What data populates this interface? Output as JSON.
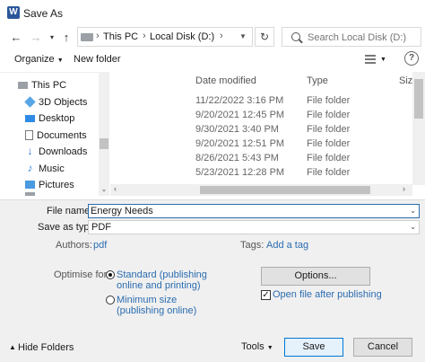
{
  "window": {
    "title": "Save As",
    "app_icon": "W"
  },
  "address": {
    "crumbs": [
      "This PC",
      "Local Disk (D:)"
    ],
    "search_placeholder": "Search Local Disk (D:)"
  },
  "toolbar": {
    "organize": "Organize",
    "new_folder": "New folder"
  },
  "nav": {
    "items": [
      {
        "label": "This PC",
        "icon": "pc-icon"
      },
      {
        "label": "3D Objects",
        "icon": "3d-objects-icon"
      },
      {
        "label": "Desktop",
        "icon": "desktop-icon"
      },
      {
        "label": "Documents",
        "icon": "documents-icon"
      },
      {
        "label": "Downloads",
        "icon": "downloads-icon"
      },
      {
        "label": "Music",
        "icon": "music-icon"
      },
      {
        "label": "Pictures",
        "icon": "pictures-icon"
      }
    ]
  },
  "files": {
    "columns": [
      "Date modified",
      "Type",
      "Size"
    ],
    "rows": [
      {
        "date": "11/22/2022 3:16 PM",
        "type": "File folder"
      },
      {
        "date": "9/20/2021 12:45 PM",
        "type": "File folder"
      },
      {
        "date": "9/30/2021 3:40 PM",
        "type": "File folder"
      },
      {
        "date": "9/20/2021 12:51 PM",
        "type": "File folder"
      },
      {
        "date": "8/26/2021 5:43 PM",
        "type": "File folder"
      },
      {
        "date": "5/23/2021 12:28 PM",
        "type": "File folder"
      }
    ]
  },
  "form": {
    "file_name_label": "File name:",
    "file_name_value": "Energy Needs",
    "save_type_label": "Save as type:",
    "save_type_value": "PDF",
    "authors_label": "Authors:",
    "authors_value": "pdf",
    "tags_label": "Tags:",
    "tags_value": "Add a tag",
    "optimise_label": "Optimise for:",
    "opt_standard_line1": "Standard (publishing",
    "opt_standard_line2": "online and printing)",
    "opt_minimum_line1": "Minimum size",
    "opt_minimum_line2": "(publishing online)",
    "options_button": "Options...",
    "open_after_label": "Open file after publishing"
  },
  "footer": {
    "hide_folders": "Hide Folders",
    "tools": "Tools",
    "save": "Save",
    "cancel": "Cancel"
  },
  "colors": {
    "accent": "#0078d7",
    "link": "#2b6cb0",
    "word": "#2b579a"
  }
}
